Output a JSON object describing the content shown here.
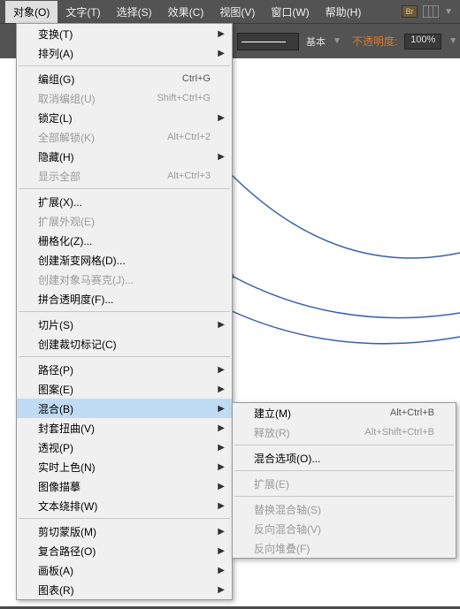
{
  "menubar": {
    "items": [
      {
        "label": "对象(O)"
      },
      {
        "label": "文字(T)"
      },
      {
        "label": "选择(S)"
      },
      {
        "label": "效果(C)"
      },
      {
        "label": "视图(V)"
      },
      {
        "label": "窗口(W)"
      },
      {
        "label": "帮助(H)"
      }
    ],
    "bridge_label": "Br"
  },
  "toolbar": {
    "stroke_preset": "基本",
    "opacity_label": "不透明度:",
    "opacity_value": "100%"
  },
  "dropdown": [
    {
      "type": "item",
      "label": "变换(T)",
      "sub": true
    },
    {
      "type": "item",
      "label": "排列(A)",
      "sub": true
    },
    {
      "type": "sep"
    },
    {
      "type": "item",
      "label": "编组(G)",
      "shortcut": "Ctrl+G"
    },
    {
      "type": "item",
      "label": "取消编组(U)",
      "shortcut": "Shift+Ctrl+G",
      "disabled": true
    },
    {
      "type": "item",
      "label": "锁定(L)",
      "sub": true
    },
    {
      "type": "item",
      "label": "全部解锁(K)",
      "shortcut": "Alt+Ctrl+2",
      "disabled": true
    },
    {
      "type": "item",
      "label": "隐藏(H)",
      "sub": true
    },
    {
      "type": "item",
      "label": "显示全部",
      "shortcut": "Alt+Ctrl+3",
      "disabled": true
    },
    {
      "type": "sep"
    },
    {
      "type": "item",
      "label": "扩展(X)..."
    },
    {
      "type": "item",
      "label": "扩展外观(E)",
      "disabled": true
    },
    {
      "type": "item",
      "label": "栅格化(Z)..."
    },
    {
      "type": "item",
      "label": "创建渐变网格(D)..."
    },
    {
      "type": "item",
      "label": "创建对象马赛克(J)...",
      "disabled": true
    },
    {
      "type": "item",
      "label": "拼合透明度(F)..."
    },
    {
      "type": "sep"
    },
    {
      "type": "item",
      "label": "切片(S)",
      "sub": true
    },
    {
      "type": "item",
      "label": "创建裁切标记(C)"
    },
    {
      "type": "sep"
    },
    {
      "type": "item",
      "label": "路径(P)",
      "sub": true
    },
    {
      "type": "item",
      "label": "图案(E)",
      "sub": true
    },
    {
      "type": "item",
      "label": "混合(B)",
      "sub": true,
      "highlighted": true
    },
    {
      "type": "item",
      "label": "封套扭曲(V)",
      "sub": true
    },
    {
      "type": "item",
      "label": "透视(P)",
      "sub": true
    },
    {
      "type": "item",
      "label": "实时上色(N)",
      "sub": true
    },
    {
      "type": "item",
      "label": "图像描摹",
      "sub": true
    },
    {
      "type": "item",
      "label": "文本绕排(W)",
      "sub": true
    },
    {
      "type": "sep"
    },
    {
      "type": "item",
      "label": "剪切蒙版(M)",
      "sub": true
    },
    {
      "type": "item",
      "label": "复合路径(O)",
      "sub": true
    },
    {
      "type": "item",
      "label": "画板(A)",
      "sub": true
    },
    {
      "type": "item",
      "label": "图表(R)",
      "sub": true
    }
  ],
  "submenu": [
    {
      "type": "item",
      "label": "建立(M)",
      "shortcut": "Alt+Ctrl+B"
    },
    {
      "type": "item",
      "label": "释放(R)",
      "shortcut": "Alt+Shift+Ctrl+B",
      "disabled": true
    },
    {
      "type": "sep"
    },
    {
      "type": "item",
      "label": "混合选项(O)..."
    },
    {
      "type": "sep"
    },
    {
      "type": "item",
      "label": "扩展(E)",
      "disabled": true
    },
    {
      "type": "sep"
    },
    {
      "type": "item",
      "label": "替换混合轴(S)",
      "disabled": true
    },
    {
      "type": "item",
      "label": "反向混合轴(V)",
      "disabled": true
    },
    {
      "type": "item",
      "label": "反向堆叠(F)",
      "disabled": true
    }
  ]
}
